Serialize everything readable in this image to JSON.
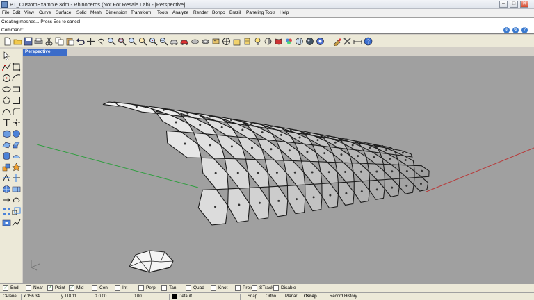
{
  "window": {
    "title": "PT_CustomExample.3dm - Rhinoceros (Not For Resale Lab) - [Perspective]",
    "buttons": {
      "minimize": "–",
      "maximize": "□",
      "close": "✕"
    }
  },
  "menu": {
    "items": [
      "File",
      "Edit",
      "View",
      "Curve",
      "Surface",
      "Solid",
      "Mesh",
      "Dimension",
      "Transform",
      "Tools",
      "Analyze",
      "Render",
      "Bongo",
      "Brazil",
      "Paneling Tools",
      "Help"
    ]
  },
  "command": {
    "history": "Creating meshes... Press Esc to cancel",
    "label": "Command:",
    "value": ""
  },
  "toolbar": {
    "icons": [
      "new-icon",
      "open-icon",
      "save-icon",
      "print-icon",
      "cut-icon",
      "copy-icon",
      "paste-icon",
      "undo-icon",
      "pan-icon",
      "rotate-icon",
      "zoom-icon",
      "zoom-window-icon",
      "zoom-extents-icon",
      "zoom-selected-icon",
      "zoom-target-icon",
      "undo-view-icon",
      "car-icon",
      "material-icon",
      "lights-icon",
      "grid-icon",
      "camera-icon",
      "display-icon",
      "layers-icon",
      "properties-icon",
      "render-icon",
      "shade-icon",
      "ghost-icon",
      "xray-icon",
      "globe-icon",
      "sphere-icon",
      "options-icon",
      "brush-icon",
      "help-icon"
    ]
  },
  "viewport": {
    "tab": "Perspective",
    "colors": {
      "background": "#a0a0a0",
      "x_axis": "#b83a3a",
      "y_axis": "#2e9e3e",
      "panel": "#f2f2f2"
    }
  },
  "osnap": {
    "items": [
      {
        "label": "End",
        "checked": true
      },
      {
        "label": "Near",
        "checked": false
      },
      {
        "label": "Point",
        "checked": true
      },
      {
        "label": "Mid",
        "checked": true
      },
      {
        "label": "Cen",
        "checked": false
      },
      {
        "label": "Int",
        "checked": false
      },
      {
        "label": "Perp",
        "checked": false
      },
      {
        "label": "Tan",
        "checked": false
      },
      {
        "label": "Quad",
        "checked": false
      },
      {
        "label": "Knot",
        "checked": false
      },
      {
        "label": "Project",
        "checked": false
      },
      {
        "label": "STrack",
        "checked": false
      },
      {
        "label": "Disable",
        "checked": false
      }
    ]
  },
  "status": {
    "cplane": "CPlane",
    "x": "x 156.34",
    "y": "y 118.11",
    "z": "z 0.00",
    "extra": "0.00",
    "layer": "Default",
    "snap": "Snap",
    "ortho": "Ortho",
    "planar": "Planar",
    "osnap": "Osnap",
    "record": "Record History"
  }
}
